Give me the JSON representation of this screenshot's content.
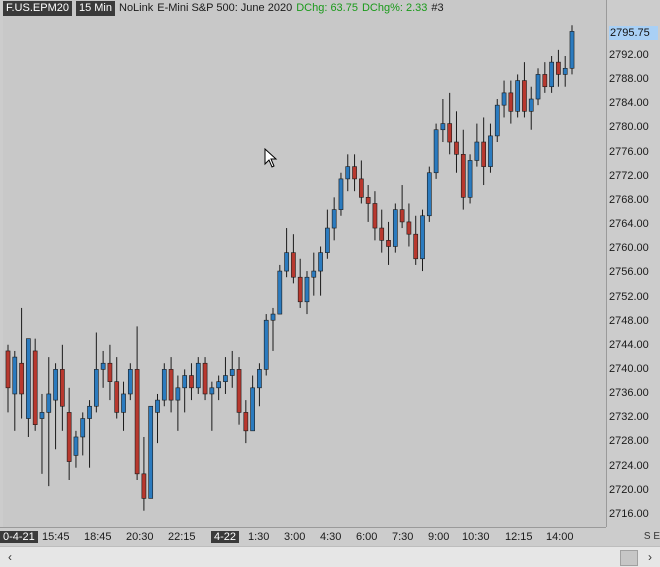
{
  "header": {
    "symbol": "F.US.EPM20",
    "interval": "15 Min",
    "feed": "NoLink",
    "instrument": "E-Mini S&P 500: June 2020",
    "dchg": "DChg: 63.75",
    "dchg_pct": "DChg%: 2.33",
    "chart_number": "#3"
  },
  "price_axis": {
    "current_price": "2795.75",
    "labels": [
      "2792.00",
      "2788.00",
      "2784.00",
      "2780.00",
      "2776.00",
      "2772.00",
      "2768.00",
      "2764.00",
      "2760.00",
      "2756.00",
      "2752.00",
      "2748.00",
      "2744.00",
      "2740.00",
      "2736.00",
      "2732.00",
      "2728.00",
      "2724.00",
      "2720.00",
      "2716.00"
    ]
  },
  "time_axis": {
    "start_date": "0-4-21",
    "labels": [
      "15:45",
      "18:45",
      "20:30",
      "22:15"
    ],
    "date2": "4-22",
    "labels2": [
      "1:30",
      "3:00",
      "4:30",
      "6:00",
      "7:30",
      "9:00",
      "10:30",
      "12:15",
      "14:00"
    ],
    "corner": "S E"
  },
  "colors": {
    "up": "#2b7bbf",
    "down": "#b8382e",
    "background": "#c8c8c8"
  },
  "icons": {
    "cursor": "mouse-pointer-icon",
    "scroll_left": "chevron-left-icon",
    "scroll_right": "chevron-right-icon"
  },
  "chart_data": {
    "type": "candlestick",
    "ylim": [
      2716,
      2798
    ],
    "candles": [
      {
        "o": 2744,
        "h": 2745,
        "l": 2734,
        "c": 2738
      },
      {
        "o": 2737,
        "h": 2744,
        "l": 2731,
        "c": 2743
      },
      {
        "o": 2742,
        "h": 2751,
        "l": 2733,
        "c": 2737
      },
      {
        "o": 2733,
        "h": 2746,
        "l": 2730,
        "c": 2746
      },
      {
        "o": 2744,
        "h": 2746,
        "l": 2731,
        "c": 2732
      },
      {
        "o": 2733,
        "h": 2737,
        "l": 2724,
        "c": 2734
      },
      {
        "o": 2734,
        "h": 2743,
        "l": 2722,
        "c": 2737
      },
      {
        "o": 2736,
        "h": 2742,
        "l": 2728,
        "c": 2741
      },
      {
        "o": 2741,
        "h": 2745,
        "l": 2731,
        "c": 2735
      },
      {
        "o": 2734,
        "h": 2738,
        "l": 2723,
        "c": 2726
      },
      {
        "o": 2727,
        "h": 2731,
        "l": 2725,
        "c": 2730
      },
      {
        "o": 2730,
        "h": 2734,
        "l": 2727,
        "c": 2733
      },
      {
        "o": 2733,
        "h": 2736,
        "l": 2725,
        "c": 2735
      },
      {
        "o": 2735,
        "h": 2747,
        "l": 2734,
        "c": 2741
      },
      {
        "o": 2741,
        "h": 2744,
        "l": 2738,
        "c": 2742
      },
      {
        "o": 2742,
        "h": 2745,
        "l": 2736,
        "c": 2739
      },
      {
        "o": 2739,
        "h": 2743,
        "l": 2733,
        "c": 2734
      },
      {
        "o": 2734,
        "h": 2739,
        "l": 2731,
        "c": 2737
      },
      {
        "o": 2737,
        "h": 2742,
        "l": 2736,
        "c": 2741
      },
      {
        "o": 2741,
        "h": 2748,
        "l": 2723,
        "c": 2724
      },
      {
        "o": 2724,
        "h": 2730,
        "l": 2718,
        "c": 2720
      },
      {
        "o": 2720,
        "h": 2735,
        "l": 2720,
        "c": 2735
      },
      {
        "o": 2734,
        "h": 2737,
        "l": 2729,
        "c": 2736
      },
      {
        "o": 2736,
        "h": 2742,
        "l": 2735,
        "c": 2741
      },
      {
        "o": 2741,
        "h": 2743,
        "l": 2734,
        "c": 2736
      },
      {
        "o": 2736,
        "h": 2740,
        "l": 2731,
        "c": 2738
      },
      {
        "o": 2738,
        "h": 2741,
        "l": 2734,
        "c": 2740
      },
      {
        "o": 2740,
        "h": 2742,
        "l": 2736,
        "c": 2738
      },
      {
        "o": 2738,
        "h": 2743,
        "l": 2737,
        "c": 2742
      },
      {
        "o": 2742,
        "h": 2743,
        "l": 2736,
        "c": 2737
      },
      {
        "o": 2737,
        "h": 2739,
        "l": 2731,
        "c": 2738
      },
      {
        "o": 2738,
        "h": 2740,
        "l": 2736,
        "c": 2739
      },
      {
        "o": 2739,
        "h": 2743,
        "l": 2737,
        "c": 2740
      },
      {
        "o": 2740,
        "h": 2744,
        "l": 2738,
        "c": 2741
      },
      {
        "o": 2741,
        "h": 2743,
        "l": 2732,
        "c": 2734
      },
      {
        "o": 2734,
        "h": 2736,
        "l": 2729,
        "c": 2731
      },
      {
        "o": 2731,
        "h": 2740,
        "l": 2731,
        "c": 2738
      },
      {
        "o": 2738,
        "h": 2742,
        "l": 2735,
        "c": 2741
      },
      {
        "o": 2741,
        "h": 2750,
        "l": 2740,
        "c": 2749
      },
      {
        "o": 2749,
        "h": 2751,
        "l": 2744,
        "c": 2750
      },
      {
        "o": 2750,
        "h": 2758,
        "l": 2750,
        "c": 2757
      },
      {
        "o": 2757,
        "h": 2764,
        "l": 2756,
        "c": 2760
      },
      {
        "o": 2760,
        "h": 2763,
        "l": 2755,
        "c": 2756
      },
      {
        "o": 2756,
        "h": 2759,
        "l": 2751,
        "c": 2752
      },
      {
        "o": 2752,
        "h": 2757,
        "l": 2750,
        "c": 2756
      },
      {
        "o": 2756,
        "h": 2760,
        "l": 2753,
        "c": 2757
      },
      {
        "o": 2757,
        "h": 2761,
        "l": 2753,
        "c": 2760
      },
      {
        "o": 2760,
        "h": 2767,
        "l": 2759,
        "c": 2764
      },
      {
        "o": 2764,
        "h": 2769,
        "l": 2762,
        "c": 2767
      },
      {
        "o": 2767,
        "h": 2773,
        "l": 2766,
        "c": 2772
      },
      {
        "o": 2772,
        "h": 2776,
        "l": 2770,
        "c": 2774
      },
      {
        "o": 2774,
        "h": 2776,
        "l": 2770,
        "c": 2772
      },
      {
        "o": 2772,
        "h": 2775,
        "l": 2768,
        "c": 2769
      },
      {
        "o": 2769,
        "h": 2771,
        "l": 2765,
        "c": 2768
      },
      {
        "o": 2768,
        "h": 2770,
        "l": 2762,
        "c": 2764
      },
      {
        "o": 2764,
        "h": 2767,
        "l": 2760,
        "c": 2762
      },
      {
        "o": 2762,
        "h": 2765,
        "l": 2758,
        "c": 2761
      },
      {
        "o": 2761,
        "h": 2768,
        "l": 2760,
        "c": 2767
      },
      {
        "o": 2767,
        "h": 2771,
        "l": 2764,
        "c": 2765
      },
      {
        "o": 2765,
        "h": 2768,
        "l": 2761,
        "c": 2763
      },
      {
        "o": 2763,
        "h": 2766,
        "l": 2758,
        "c": 2759
      },
      {
        "o": 2759,
        "h": 2767,
        "l": 2757,
        "c": 2766
      },
      {
        "o": 2766,
        "h": 2774,
        "l": 2765,
        "c": 2773
      },
      {
        "o": 2773,
        "h": 2781,
        "l": 2772,
        "c": 2780
      },
      {
        "o": 2780,
        "h": 2785,
        "l": 2778,
        "c": 2781
      },
      {
        "o": 2781,
        "h": 2786,
        "l": 2776,
        "c": 2778
      },
      {
        "o": 2778,
        "h": 2783,
        "l": 2773,
        "c": 2776
      },
      {
        "o": 2776,
        "h": 2780,
        "l": 2767,
        "c": 2769
      },
      {
        "o": 2769,
        "h": 2776,
        "l": 2768,
        "c": 2775
      },
      {
        "o": 2775,
        "h": 2781,
        "l": 2774,
        "c": 2778
      },
      {
        "o": 2778,
        "h": 2782,
        "l": 2771,
        "c": 2774
      },
      {
        "o": 2774,
        "h": 2781,
        "l": 2773,
        "c": 2779
      },
      {
        "o": 2779,
        "h": 2785,
        "l": 2778,
        "c": 2784
      },
      {
        "o": 2784,
        "h": 2788,
        "l": 2782,
        "c": 2786
      },
      {
        "o": 2786,
        "h": 2788,
        "l": 2781,
        "c": 2783
      },
      {
        "o": 2783,
        "h": 2789,
        "l": 2782,
        "c": 2788
      },
      {
        "o": 2788,
        "h": 2791,
        "l": 2782,
        "c": 2783
      },
      {
        "o": 2783,
        "h": 2787,
        "l": 2780,
        "c": 2785
      },
      {
        "o": 2785,
        "h": 2790,
        "l": 2784,
        "c": 2789
      },
      {
        "o": 2789,
        "h": 2791,
        "l": 2786,
        "c": 2787
      },
      {
        "o": 2787,
        "h": 2792,
        "l": 2786,
        "c": 2791
      },
      {
        "o": 2791,
        "h": 2793,
        "l": 2787,
        "c": 2789
      },
      {
        "o": 2789,
        "h": 2792,
        "l": 2787,
        "c": 2790
      },
      {
        "o": 2790,
        "h": 2797,
        "l": 2789,
        "c": 2796
      }
    ]
  }
}
